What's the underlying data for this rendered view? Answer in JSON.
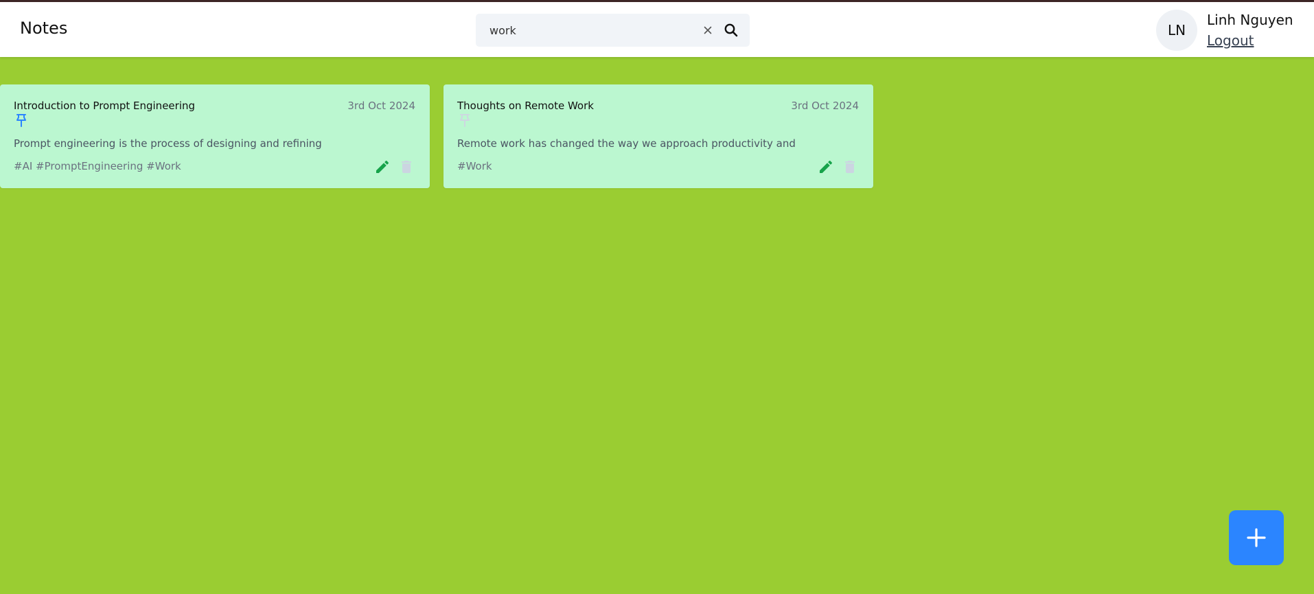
{
  "app": {
    "title": "Notes"
  },
  "search": {
    "value": "work",
    "clear_icon": "close-icon",
    "search_icon": "search-icon"
  },
  "user": {
    "initials": "LN",
    "name": "Linh Nguyen",
    "logout_label": "Logout"
  },
  "notes": [
    {
      "title": "Introduction to Prompt Engineering",
      "date": "3rd Oct 2024",
      "pinned": true,
      "content": "Prompt engineering is the process of designing and refining",
      "tags": "#AI #PromptEngineering #Work"
    },
    {
      "title": "Thoughts on Remote Work",
      "date": "3rd Oct 2024",
      "pinned": false,
      "content": "Remote work has changed the way we approach productivity and",
      "tags": "#Work"
    }
  ],
  "colors": {
    "background": "#9acd32",
    "card": "#bbf7d0",
    "accent_blue": "#2b85ff",
    "edit_green": "#16a34a",
    "delete_gray": "#cbd5e1"
  },
  "actions": {
    "add_icon": "plus-icon"
  }
}
